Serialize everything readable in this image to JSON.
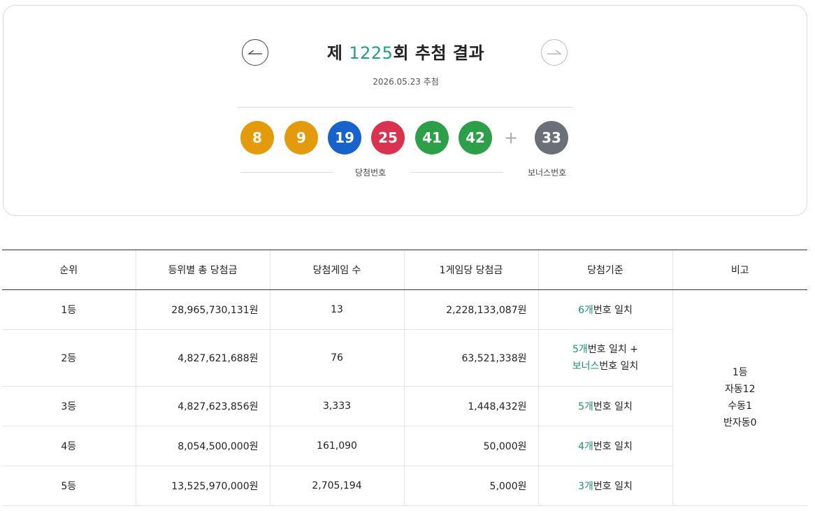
{
  "header": {
    "title_prefix": "제 ",
    "round_number": "1225",
    "title_suffix": "회 추첨 결과",
    "draw_date": "2026.05.23 추첨"
  },
  "numbers": {
    "winning": [
      {
        "value": "8",
        "color": "#e39a0c"
      },
      {
        "value": "9",
        "color": "#e39a0c"
      },
      {
        "value": "19",
        "color": "#1862cc"
      },
      {
        "value": "25",
        "color": "#d9334f"
      },
      {
        "value": "41",
        "color": "#2d9f48"
      },
      {
        "value": "42",
        "color": "#2d9f48"
      }
    ],
    "plus": "+",
    "bonus": {
      "value": "33",
      "color": "#6b6f78"
    },
    "winning_label": "당첨번호",
    "bonus_label": "보너스번호"
  },
  "table": {
    "headers": [
      "순위",
      "등위별 총 당첨금",
      "당첨게임 수",
      "1게임당 당첨금",
      "당첨기준",
      "비고"
    ],
    "rows": [
      {
        "rank": "1등",
        "total": "28,965,730,131원",
        "games": "13",
        "per_game": "2,228,133,087원",
        "cond_num": "6개",
        "cond_text": "번호 일치"
      },
      {
        "rank": "2등",
        "total": "4,827,621,688원",
        "games": "76",
        "per_game": "63,521,338원",
        "cond_num": "5개",
        "cond_text": "번호 일치 +",
        "cond2_num": "보너스",
        "cond2_text": "번호 일치"
      },
      {
        "rank": "3등",
        "total": "4,827,623,856원",
        "games": "3,333",
        "per_game": "1,448,432원",
        "cond_num": "5개",
        "cond_text": "번호 일치"
      },
      {
        "rank": "4등",
        "total": "8,054,500,000원",
        "games": "161,090",
        "per_game": "50,000원",
        "cond_num": "4개",
        "cond_text": "번호 일치"
      },
      {
        "rank": "5등",
        "total": "13,525,970,000원",
        "games": "2,705,194",
        "per_game": "5,000원",
        "cond_num": "3개",
        "cond_text": "번호 일치"
      }
    ],
    "note_lines": [
      "1등",
      "자동12",
      "수동1",
      "반자동0"
    ]
  },
  "colors": {
    "accent": "#1f8f74"
  },
  "icons": {
    "prev": "arrow-left-icon",
    "next": "arrow-right-icon"
  }
}
